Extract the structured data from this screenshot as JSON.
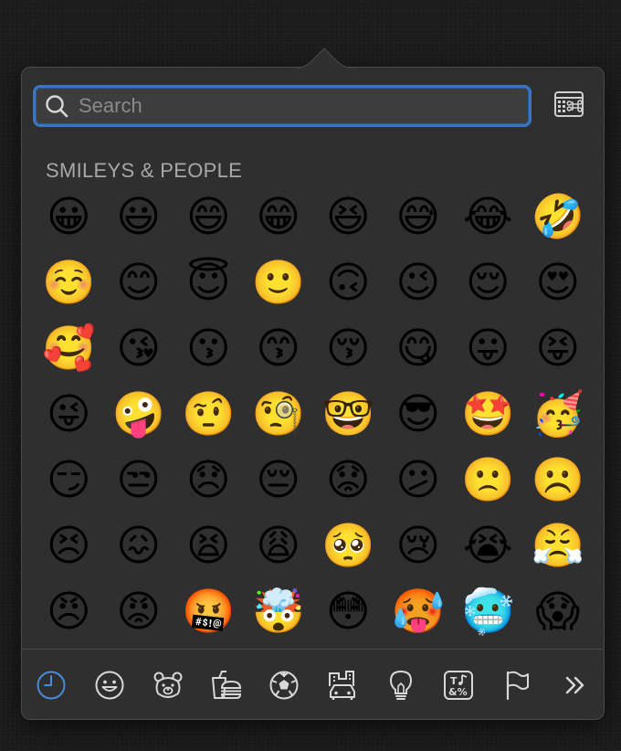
{
  "search": {
    "placeholder": "Search",
    "value": ""
  },
  "section": {
    "title": "SMILEYS & PEOPLE"
  },
  "emojis": [
    "😀",
    "😃",
    "😄",
    "😁",
    "😆",
    "😅",
    "😂",
    "🤣",
    "☺️",
    "😊",
    "😇",
    "🙂",
    "🙃",
    "😉",
    "😌",
    "😍",
    "🥰",
    "😘",
    "😗",
    "😙",
    "😚",
    "😋",
    "😛",
    "😝",
    "😜",
    "🤪",
    "🤨",
    "🧐",
    "🤓",
    "😎",
    "🤩",
    "🥳",
    "😏",
    "😒",
    "😞",
    "😔",
    "😟",
    "😕",
    "🙁",
    "☹️",
    "😣",
    "😖",
    "😫",
    "😩",
    "🥺",
    "😢",
    "😭",
    "😤",
    "😠",
    "😡",
    "🤬",
    "🤯",
    "😳",
    "🥵",
    "🥶",
    "😱"
  ],
  "categories": [
    {
      "name": "recent-icon",
      "active": true
    },
    {
      "name": "smiley-icon"
    },
    {
      "name": "animal-icon"
    },
    {
      "name": "food-icon"
    },
    {
      "name": "activity-icon"
    },
    {
      "name": "travel-icon"
    },
    {
      "name": "objects-icon"
    },
    {
      "name": "symbols-icon"
    },
    {
      "name": "flag-icon"
    },
    {
      "name": "more-icon"
    }
  ],
  "colors": {
    "accent": "#3a76c4",
    "active_icon": "#4a8ad8",
    "icon": "#d8d8d8",
    "panel": "#2f2f2f"
  }
}
